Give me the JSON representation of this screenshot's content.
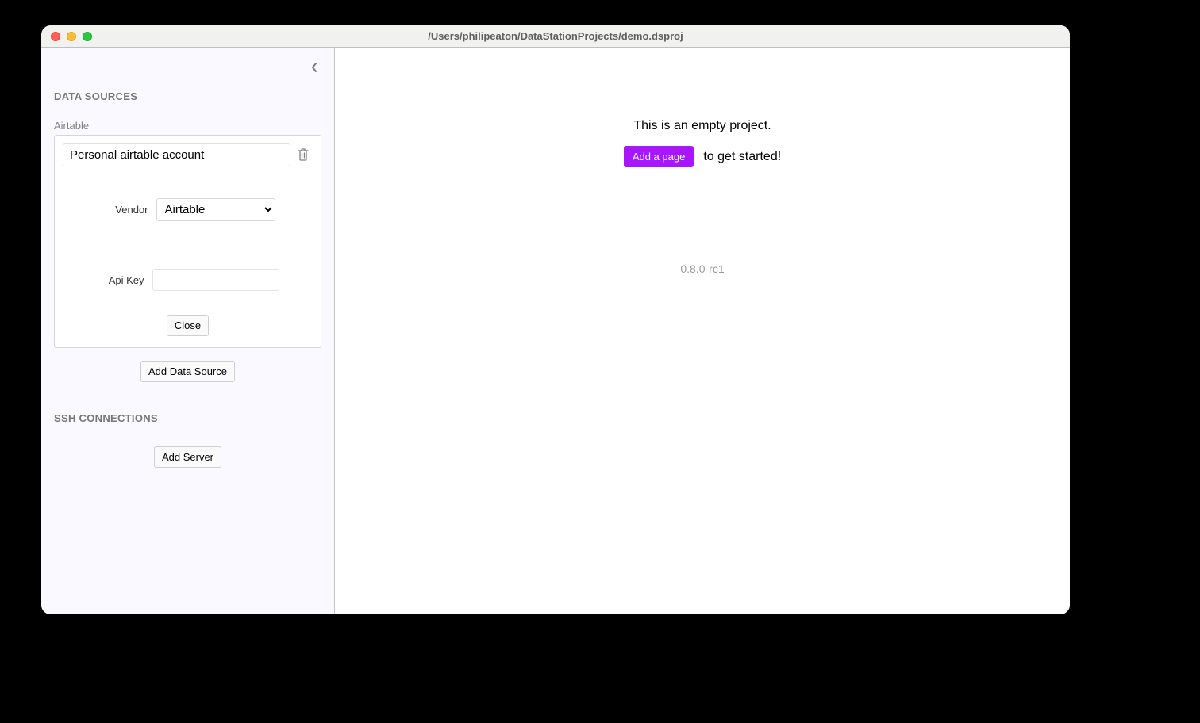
{
  "window": {
    "title": "/Users/philipeaton/DataStationProjects/demo.dsproj"
  },
  "sidebar": {
    "data_sources_header": "DATA SOURCES",
    "ssh_header": "SSH CONNECTIONS",
    "add_data_source_label": "Add Data Source",
    "add_server_label": "Add Server",
    "data_sources": [
      {
        "type_label": "Airtable",
        "name_value": "Personal airtable account",
        "vendor_label": "Vendor",
        "vendor_value": "Airtable",
        "vendor_options": [
          "Airtable"
        ],
        "apikey_label": "Api Key",
        "apikey_value": "",
        "close_label": "Close"
      }
    ]
  },
  "main": {
    "empty_project_text": "This is an empty project.",
    "add_page_label": "Add a page",
    "get_started_text": " to get started!",
    "version": "0.8.0-rc1"
  }
}
